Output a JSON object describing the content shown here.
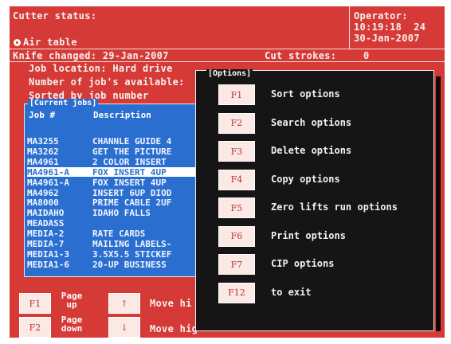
{
  "header": {
    "cutter_status_label": "Cutter status:",
    "operator_label": "Operator:",
    "time": "10:19:18  24",
    "date": "30-Jan-2007",
    "air_table_label": "Air table",
    "knife_changed": "Knife changed: 29-Jan-2007",
    "cut_strokes_label": "Cut strokes:",
    "cut_strokes_value": "0"
  },
  "info": {
    "job_location": "Job location: Hard drive",
    "jobs_available": "Number of job's available:",
    "sorted_by": "Sorted by job number"
  },
  "jobs_list": {
    "title": "[Current jobs]",
    "col_job": "Job #",
    "col_desc": "Description",
    "rows": [
      {
        "id": "MA3255",
        "desc": "CHANNLE GUIDE 4"
      },
      {
        "id": "MA3262",
        "desc": "GET THE PICTURE"
      },
      {
        "id": "MA4961",
        "desc": "2 COLOR INSERT"
      },
      {
        "id": "MA4961-A",
        "desc": "FOX INSERT 4UP"
      },
      {
        "id": "MA4961-A",
        "desc": "FOX INSERT 4UP"
      },
      {
        "id": "MA4962",
        "desc": "INSERT 6UP DIOD"
      },
      {
        "id": "MA8000",
        "desc": "PRIME CABLE 2UF"
      },
      {
        "id": "MAIDAHO",
        "desc": "IDAHO FALLS"
      },
      {
        "id": "MEADASS",
        "desc": ""
      },
      {
        "id": "MEDIA-2",
        "desc": "RATE CARDS"
      },
      {
        "id": "MEDIA-7",
        "desc": "MAILING LABELS-"
      },
      {
        "id": "MEDIA1-3",
        "desc": "3.5X5.5 STICKEF"
      },
      {
        "id": "MEDIA1-6",
        "desc": "20-UP BUSINESS"
      }
    ],
    "selected_index": 3
  },
  "bottom_keys": {
    "f1": "F1",
    "f1_label_1": "Page",
    "f1_label_2": "up",
    "f2": "F2",
    "f2_label_1": "Page",
    "f2_label_2": "down",
    "up_arrow": "↑",
    "down_arrow": "↓",
    "move_up_text": "Move hi",
    "move_down_text": "Move hig",
    "f12_partial": "F12",
    "exit_partial": "to exit"
  },
  "options": {
    "title": "[Options]",
    "items": [
      {
        "key": "F1",
        "label": "Sort options"
      },
      {
        "key": "F2",
        "label": "Search options"
      },
      {
        "key": "F3",
        "label": "Delete options"
      },
      {
        "key": "F4",
        "label": "Copy options"
      },
      {
        "key": "F5",
        "label": "Zero lifts run options"
      },
      {
        "key": "F6",
        "label": "Print options"
      },
      {
        "key": "F7",
        "label": "CIP options"
      },
      {
        "key": "F12",
        "label": "to exit"
      }
    ]
  },
  "colors": {
    "background": "#d63a36",
    "jobs_panel": "#2a6fd0",
    "options_panel": "#151515",
    "key_face": "#fbe9e6"
  }
}
